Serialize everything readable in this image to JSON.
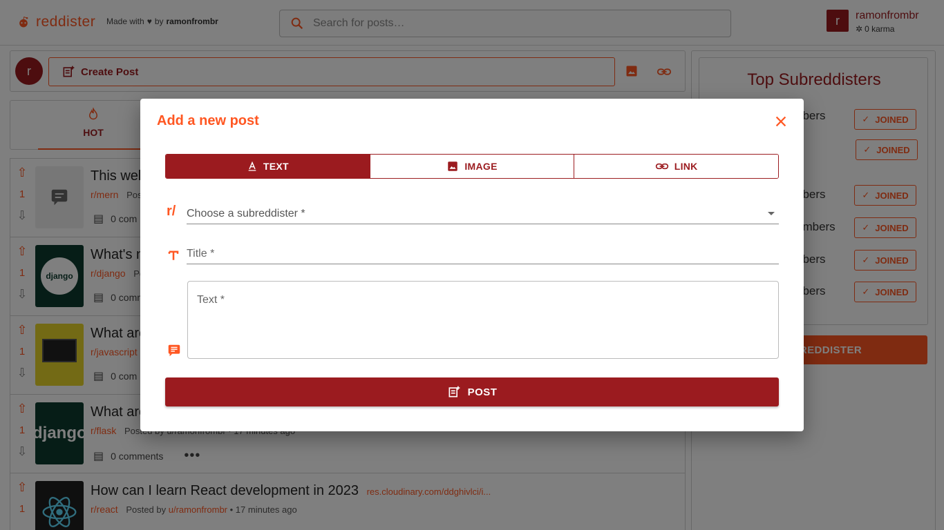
{
  "header": {
    "brand": "reddister",
    "made_with": "Made with",
    "by": "by",
    "made_by_user": "ramonfrombr",
    "search_placeholder": "Search for posts…",
    "user": {
      "avatar_letter": "r",
      "name": "ramonfrombr",
      "karma": "0 karma"
    }
  },
  "create_bar": {
    "avatar_letter": "r",
    "button_label": "Create Post"
  },
  "sort_tabs": [
    {
      "label": "HOT"
    }
  ],
  "posts": [
    {
      "votes": "1",
      "title": "This wel",
      "subreddit": "r/mern",
      "meta": "Pos",
      "comments": "0 com"
    },
    {
      "votes": "1",
      "title": "What's n",
      "subreddit": "r/django",
      "meta": "Po",
      "comments": "0 comm"
    },
    {
      "votes": "1",
      "title": "What are",
      "subreddit": "r/javascript",
      "meta": "",
      "comments": "0 com"
    },
    {
      "votes": "1",
      "title": "What are",
      "subreddit": "r/flask",
      "meta": "Posted by u/ramonfrombr · 17 minutes ago",
      "comments": "0 comments"
    },
    {
      "votes": "1",
      "title": "How can I learn React development in 2023",
      "link": "res.cloudinary.com/ddghivlci/i...",
      "subreddit": "r/react",
      "posted_by": "Posted by",
      "author": "u/ramonfrombr",
      "time": "• 17 minutes ago"
    }
  ],
  "sidebar": {
    "title": "Top Subreddisters",
    "rows": [
      {
        "members": "nbers",
        "button": "JOINED"
      },
      {
        "members": "",
        "button": "JOINED"
      },
      {
        "members": "nbers",
        "button": "JOINED"
      },
      {
        "members": "embers",
        "button": "JOINED"
      },
      {
        "members": "nbers",
        "button": "JOINED"
      },
      {
        "members": "nbers",
        "button": "JOINED"
      }
    ],
    "new_button": "W SUBREDDISTER"
  },
  "modal": {
    "title": "Add a new post",
    "tabs": [
      {
        "label": "TEXT"
      },
      {
        "label": "IMAGE"
      },
      {
        "label": "LINK"
      }
    ],
    "subreddit_prefix": "r/",
    "subreddit_placeholder": "Choose a subreddister *",
    "title_placeholder": "Title *",
    "text_placeholder": "Text *",
    "post_button": "POST"
  },
  "colors": {
    "primary": "#9b1b1f",
    "accent": "#ff5722"
  }
}
